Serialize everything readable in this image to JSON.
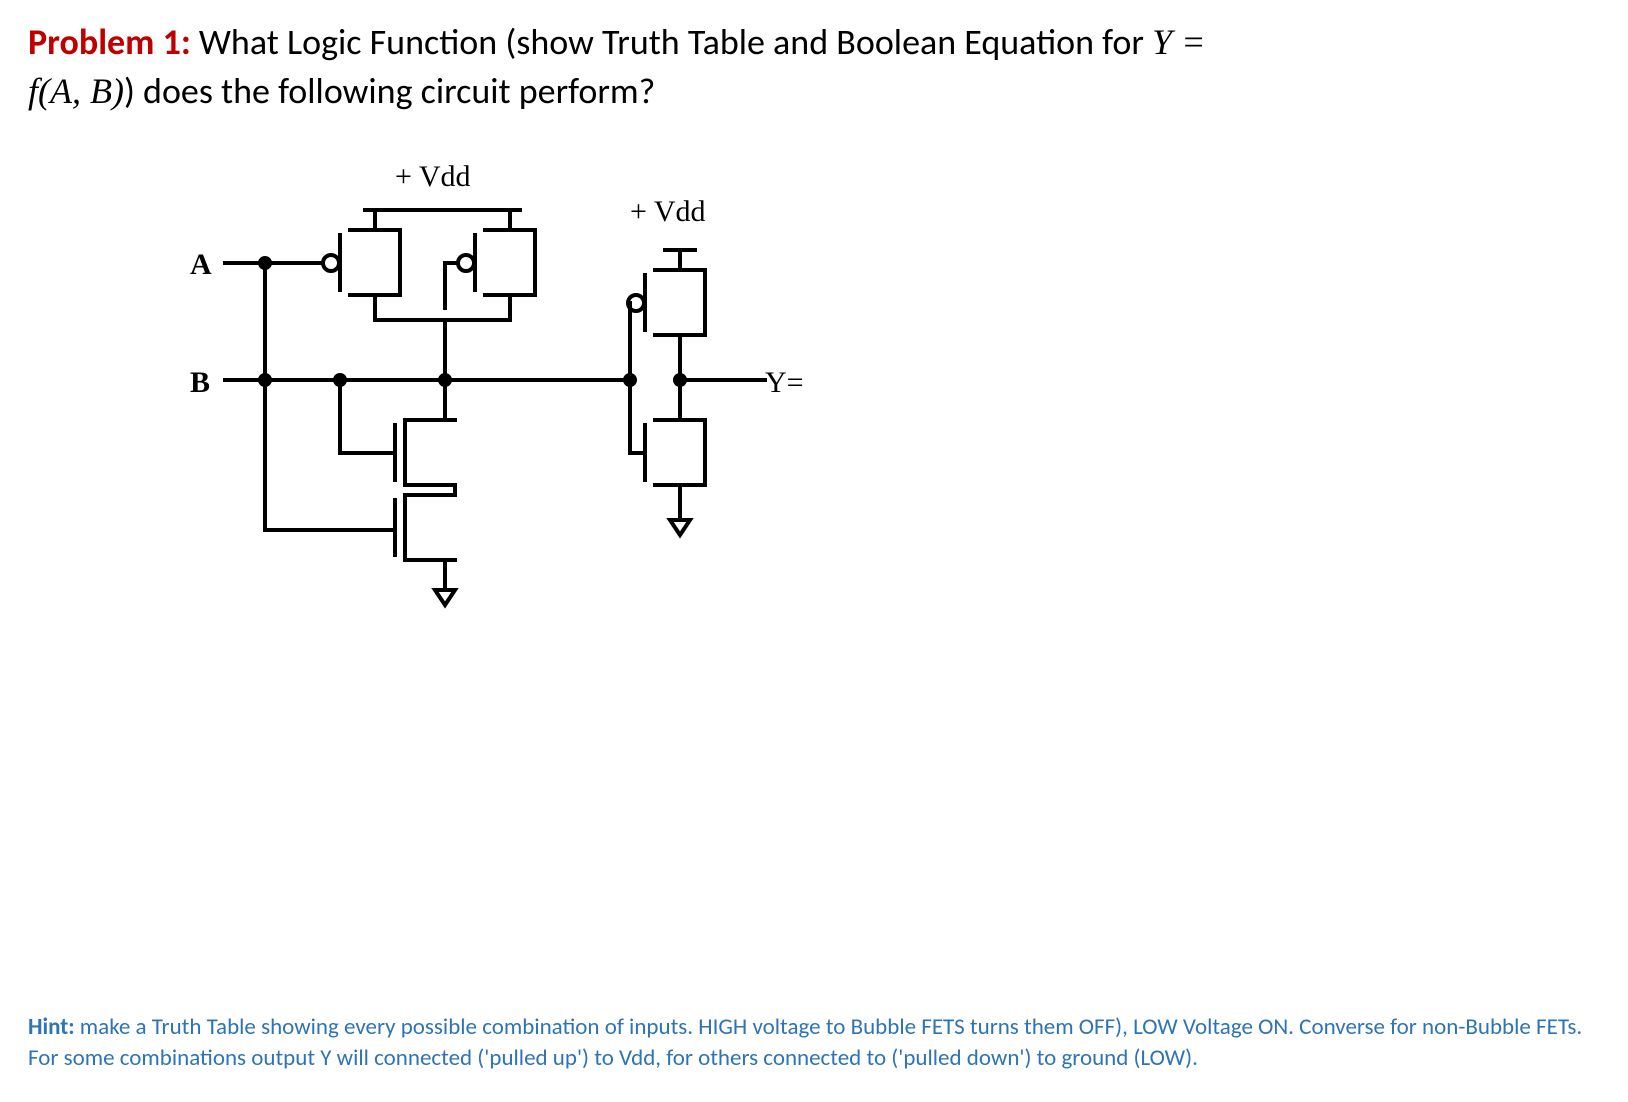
{
  "problem": {
    "label": "Problem 1:",
    "text_part1": "  What Logic Function (show Truth Table and Boolean Equation for ",
    "y_eq": "Y =",
    "fab": "f(A, B)",
    "text_part2": ") does the following circuit perform?"
  },
  "diagram": {
    "vdd1": "+ Vdd",
    "vdd2": "+ Vdd",
    "input_a": "A",
    "input_b": "B",
    "output_y": "Y="
  },
  "hint": {
    "label": "Hint:",
    "body": " make a Truth Table showing every possible combination of inputs.  HIGH voltage to Bubble FETS turns them OFF), LOW Voltage ON. Converse for non-Bubble FETs. For some combinations output Y will connected ('pulled up') to Vdd, for others connected to ('pulled down') to ground (LOW)."
  }
}
